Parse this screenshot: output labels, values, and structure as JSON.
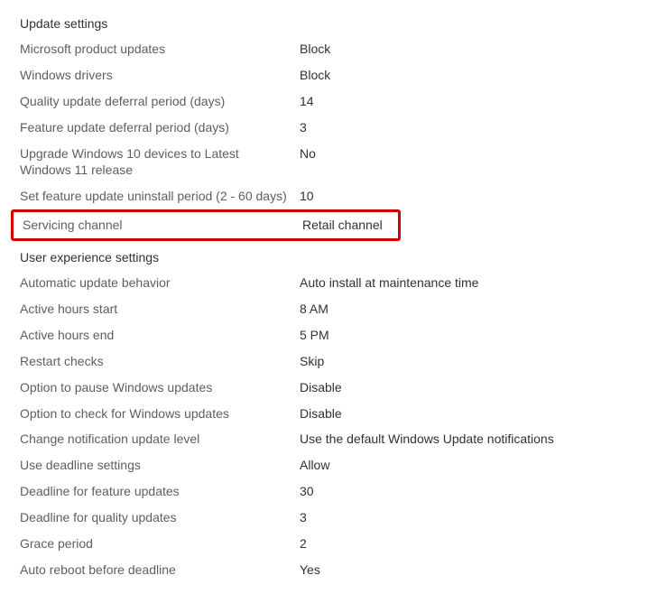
{
  "sections": [
    {
      "title": "Update settings",
      "rows": [
        {
          "label": "Microsoft product updates",
          "value": "Block",
          "highlight": false
        },
        {
          "label": "Windows drivers",
          "value": "Block",
          "highlight": false
        },
        {
          "label": "Quality update deferral period (days)",
          "value": "14",
          "highlight": false
        },
        {
          "label": "Feature update deferral period (days)",
          "value": "3",
          "highlight": false
        },
        {
          "label": "Upgrade Windows 10 devices to Latest Windows 11 release",
          "value": "No",
          "highlight": false
        },
        {
          "label": "Set feature update uninstall period (2 - 60 days)",
          "value": "10",
          "highlight": false
        },
        {
          "label": "Servicing channel",
          "value": "Retail channel",
          "highlight": true
        }
      ]
    },
    {
      "title": "User experience settings",
      "rows": [
        {
          "label": "Automatic update behavior",
          "value": "Auto install at maintenance time",
          "highlight": false
        },
        {
          "label": "Active hours start",
          "value": "8 AM",
          "highlight": false
        },
        {
          "label": "Active hours end",
          "value": "5 PM",
          "highlight": false
        },
        {
          "label": "Restart checks",
          "value": "Skip",
          "highlight": false
        },
        {
          "label": "Option to pause Windows updates",
          "value": "Disable",
          "highlight": false
        },
        {
          "label": "Option to check for Windows updates",
          "value": "Disable",
          "highlight": false
        },
        {
          "label": "Change notification update level",
          "value": "Use the default Windows Update notifications",
          "highlight": false
        },
        {
          "label": "Use deadline settings",
          "value": "Allow",
          "highlight": false
        },
        {
          "label": "Deadline for feature updates",
          "value": "30",
          "highlight": false
        },
        {
          "label": "Deadline for quality updates",
          "value": "3",
          "highlight": false
        },
        {
          "label": "Grace period",
          "value": "2",
          "highlight": false
        },
        {
          "label": "Auto reboot before deadline",
          "value": "Yes",
          "highlight": false
        }
      ]
    }
  ]
}
